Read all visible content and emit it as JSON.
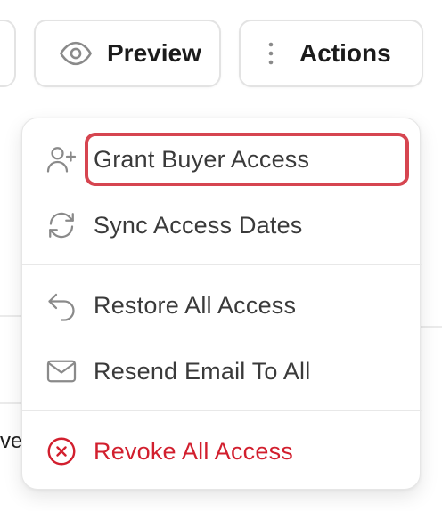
{
  "toolbar": {
    "preview_label": "Preview",
    "preview_icon": "eye-icon",
    "actions_label": "Actions",
    "actions_icon": "more-vertical-icon"
  },
  "background": {
    "partial_text": "ve"
  },
  "menu": {
    "items": [
      {
        "label": "Grant Buyer Access",
        "icon": "user-plus-icon",
        "highlighted": true
      },
      {
        "label": "Sync Access Dates",
        "icon": "refresh-icon"
      },
      {
        "label": "Restore All Access",
        "icon": "undo-arrow-icon"
      },
      {
        "label": "Resend Email To All",
        "icon": "mail-icon"
      },
      {
        "label": "Revoke All Access",
        "icon": "x-circle-icon",
        "color": "#d21f2e"
      }
    ]
  },
  "colors": {
    "danger": "#d21f2e",
    "highlight_border": "#d64550",
    "icon_gray": "#8a8a8a"
  }
}
